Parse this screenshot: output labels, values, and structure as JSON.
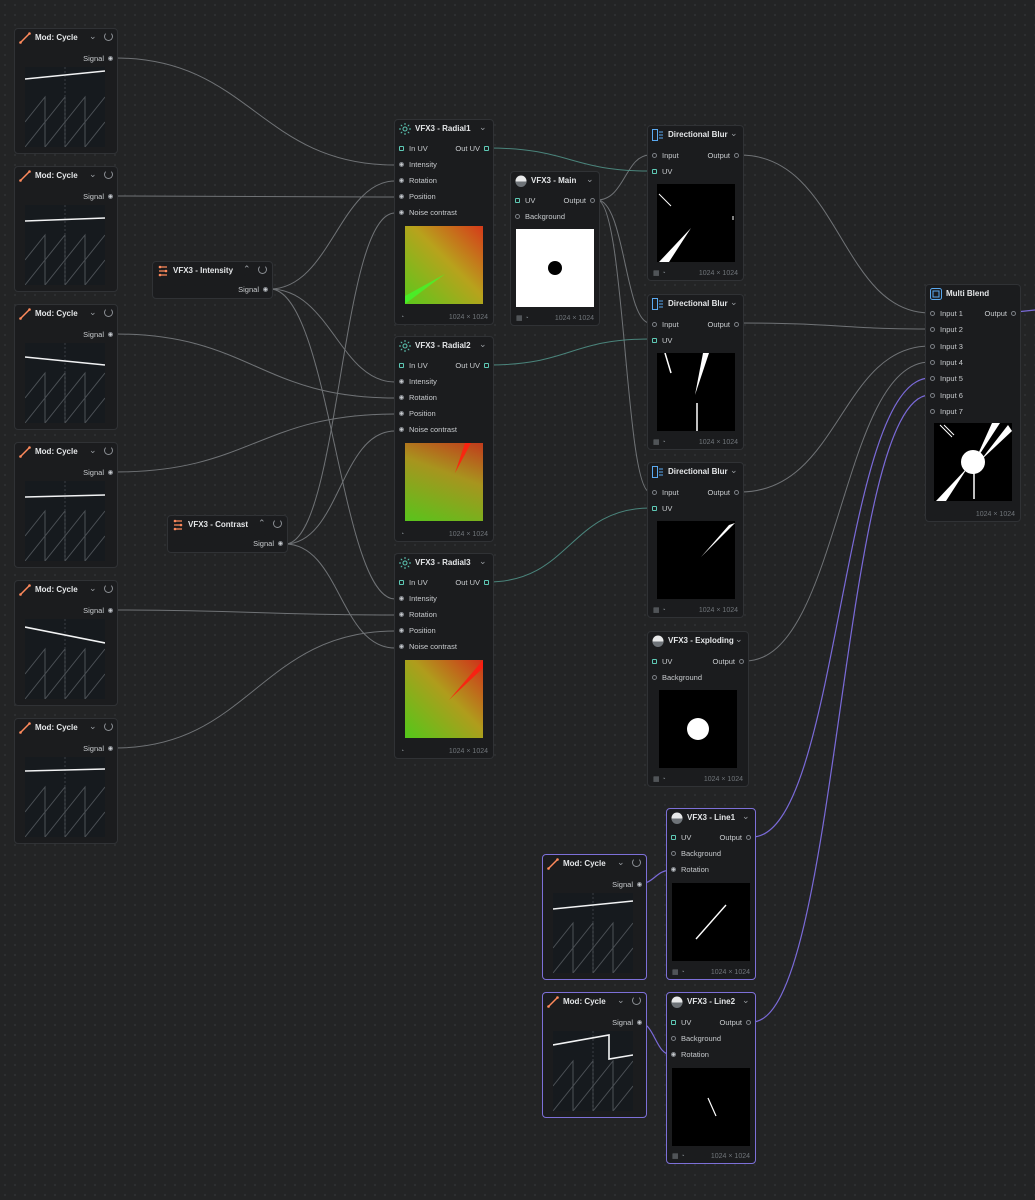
{
  "nodes": {
    "cycle1": {
      "title": "Mod: Cycle",
      "out": "Signal"
    },
    "cycle2": {
      "title": "Mod: Cycle",
      "out": "Signal"
    },
    "cycle3": {
      "title": "Mod: Cycle",
      "out": "Signal"
    },
    "cycle4": {
      "title": "Mod: Cycle",
      "out": "Signal"
    },
    "cycle5": {
      "title": "Mod: Cycle",
      "out": "Signal"
    },
    "cycle6": {
      "title": "Mod: Cycle",
      "out": "Signal"
    },
    "cycle7": {
      "title": "Mod: Cycle",
      "out": "Signal"
    },
    "cycle8": {
      "title": "Mod: Cycle",
      "out": "Signal"
    },
    "intensity": {
      "title": "VFX3 - Intensity",
      "out": "Signal"
    },
    "contrast": {
      "title": "VFX3 - Contrast",
      "out": "Signal"
    },
    "radial1": {
      "title": "VFX3 - Radial1",
      "in_uv": "In UV",
      "out_uv": "Out UV",
      "inputs": [
        "Intensity",
        "Rotation",
        "Position",
        "Noise contrast"
      ],
      "size": "1024 × 1024"
    },
    "radial2": {
      "title": "VFX3 - Radial2",
      "in_uv": "In UV",
      "out_uv": "Out UV",
      "inputs": [
        "Intensity",
        "Rotation",
        "Position",
        "Noise contrast"
      ],
      "size": "1024 × 1024"
    },
    "radial3": {
      "title": "VFX3 - Radial3",
      "in_uv": "In UV",
      "out_uv": "Out UV",
      "inputs": [
        "Intensity",
        "Rotation",
        "Position",
        "Noise contrast"
      ],
      "size": "1024 × 1024"
    },
    "main": {
      "title": "VFX3 - Main",
      "uv": "UV",
      "output": "Output",
      "background": "Background",
      "size": "1024 × 1024"
    },
    "blur1": {
      "title": "Directional Blur",
      "input": "Input",
      "output": "Output",
      "uv": "UV",
      "size": "1024 × 1024"
    },
    "blur2": {
      "title": "Directional Blur",
      "input": "Input",
      "output": "Output",
      "uv": "UV",
      "size": "1024 × 1024"
    },
    "blur3": {
      "title": "Directional Blur",
      "input": "Input",
      "output": "Output",
      "uv": "UV",
      "size": "1024 × 1024"
    },
    "exploding": {
      "title": "VFX3 - Exploding",
      "uv": "UV",
      "output": "Output",
      "background": "Background",
      "size": "1024 × 1024"
    },
    "line1": {
      "title": "VFX3 - Line1",
      "uv": "UV",
      "output": "Output",
      "background": "Background",
      "rotation": "Rotation",
      "size": "1024 × 1024"
    },
    "line2": {
      "title": "VFX3 - Line2",
      "uv": "UV",
      "output": "Output",
      "background": "Background",
      "rotation": "Rotation",
      "size": "1024 × 1024"
    },
    "multiblend": {
      "title": "Multi Blend",
      "output": "Output",
      "inputs": [
        "Input 1",
        "Input 2",
        "Input 3",
        "Input 4",
        "Input 5",
        "Input 6",
        "Input 7"
      ],
      "size": "1024 × 1024"
    }
  },
  "icons": {
    "cycle": "modulator-curve-icon",
    "vfx": "sphere-icon",
    "radial": "radial-burst-icon",
    "blur": "directional-blur-icon",
    "blend": "multi-blend-icon",
    "menu": "chevron-down-icon",
    "power": "power-icon",
    "signal_node": "modulator-nodes-icon"
  },
  "colors": {
    "canvas": "#232425",
    "node": "#1b1c1e",
    "wire": "#7d8084",
    "wire_uv": "#4f8f85",
    "wire_selected": "#7a6ad8",
    "accent_orange": "#ff8a5c",
    "accent_teal": "#5ec9b5",
    "accent_blue": "#5aa9f0"
  }
}
